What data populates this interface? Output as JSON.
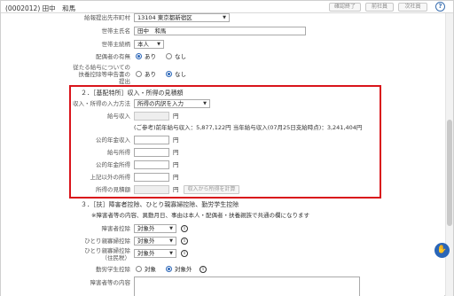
{
  "header": {
    "employee": "(0002012) 田中　和馬",
    "confirm_label": "確認終了",
    "prev_label": "前社員",
    "next_label": "次社員",
    "help": "?"
  },
  "upper": {
    "municipality_label": "給報提出先市町村",
    "municipality_value": "13104 東京都新宿区",
    "householder_name_label": "世帯主氏名",
    "householder_name_value": "田中　和馬",
    "householder_rel_label": "世帯主続柄",
    "householder_rel_value": "本人",
    "spouse_label": "配偶者の有無",
    "spouse_yes": "あり",
    "spouse_no": "なし",
    "dependent_label_1": "従たる給与についての",
    "dependent_label_2": "扶養控除等申告書の",
    "dependent_label_3": "提出",
    "dependent_yes": "あり",
    "dependent_no": "なし"
  },
  "section2": {
    "title": "２．［基配特所］収入・所得の見積額",
    "input_method_label": "収入・所得の入力方法",
    "input_method_value": "所得の内訳を入力",
    "salary_income_label": "給与収入",
    "yen": "円",
    "reference_text": "(ご参考)前年給与収入：5,877,122円 当年給与収入(07月25日支給時点)：3,241,404円",
    "pension_income_label": "公的年金収入",
    "salary_earnings_label": "給与所得",
    "pension_earnings_label": "公的年金所得",
    "other_earnings_label": "上記以外の所得",
    "estimate_label": "所得の見積額",
    "calc_button": "収入から所得を計算"
  },
  "section3": {
    "title": "３．［扶］障害者控除、ひとり親寡婦控除、勤労学生控除",
    "note": "※障害者等の内容、異動月日、事由は本人・配偶者・扶養親族で共通の欄になります",
    "disability_label": "障害者控除",
    "disability_value": "対象外",
    "single_parent_label": "ひとり親寡婦控除",
    "single_parent_value": "対象外",
    "single_parent_resident_label_1": "ひとり親寡婦控除",
    "single_parent_resident_label_2": "（住民税）",
    "single_parent_resident_value": "対象外",
    "student_label": "勤労学生控除",
    "student_target": "対象",
    "student_non_target": "対象外",
    "disability_detail_label": "障害者等の内容"
  }
}
